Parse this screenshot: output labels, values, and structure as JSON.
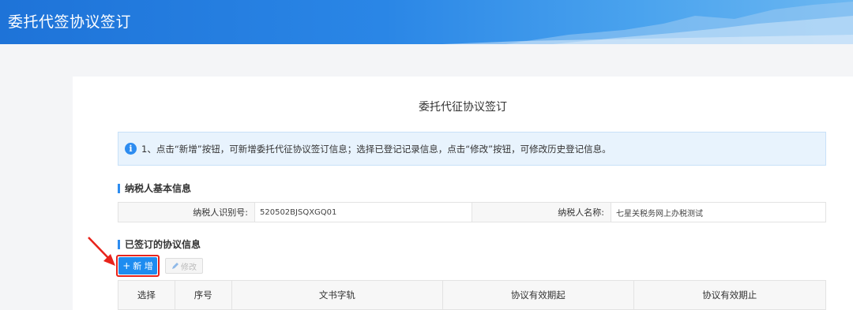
{
  "header": {
    "title": "委托代签协议签订"
  },
  "page": {
    "title": "委托代征协议签订"
  },
  "notice": {
    "text": "1、点击“新增”按钮，可新增委托代征协议签订信息；选择已登记记录信息，点击“修改”按钮，可修改历史登记信息。"
  },
  "basic_info": {
    "section_title": "纳税人基本信息",
    "taxpayer_id_label": "纳税人识别号:",
    "taxpayer_id_value": "520502BJSQXGQ01",
    "taxpayer_name_label": "纳税人名称:",
    "taxpayer_name_value": "七星关税务网上办税测试"
  },
  "agreements": {
    "section_title": "已签订的协议信息",
    "add_label": "新 增",
    "edit_label": "修改",
    "columns": [
      "选择",
      "序号",
      "文书字轨",
      "协议有效期起",
      "协议有效期止"
    ]
  },
  "colors": {
    "accent": "#2d8cf0",
    "highlight": "#e8231b"
  }
}
